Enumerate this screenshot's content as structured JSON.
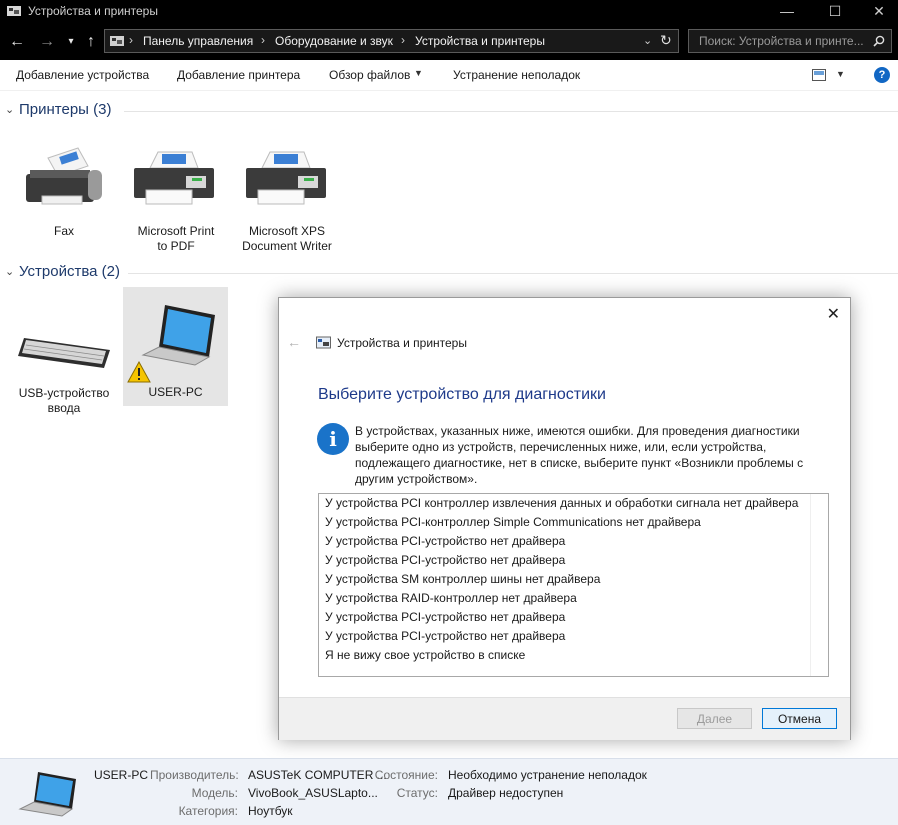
{
  "window": {
    "title": "Устройства и принтеры",
    "controls": {
      "minimize": "—",
      "maximize": "☐",
      "close": "✕"
    }
  },
  "address_bar": {
    "crumbs": [
      "Панель управления",
      "Оборудование и звук",
      "Устройства и принтеры"
    ],
    "separator": "›",
    "search_placeholder": "Поиск: Устройства и принте..."
  },
  "toolbar": {
    "add_device": "Добавление устройства",
    "add_printer": "Добавление принтера",
    "browse_files": "Обзор файлов",
    "troubleshoot": "Устранение неполадок",
    "help": "?"
  },
  "groups": {
    "printers": {
      "title": "Принтеры (3)",
      "items": [
        {
          "line1": "Fax",
          "line2": ""
        },
        {
          "line1": "Microsoft Print",
          "line2": "to PDF"
        },
        {
          "line1": "Microsoft XPS",
          "line2": "Document Writer"
        }
      ]
    },
    "devices": {
      "title": "Устройства (2)",
      "items": [
        {
          "line1": "USB-устройство",
          "line2": "ввода"
        },
        {
          "line1": "USER-PC",
          "line2": ""
        }
      ]
    }
  },
  "dialog": {
    "title": "Устройства и принтеры",
    "heading": "Выберите устройство для диагностики",
    "description": "В устройствах, указанных ниже, имеются ошибки. Для проведения диагностики выберите одно из устройств, перечисленных ниже, или, если устройства, подлежащего диагностике, нет в списке, выберите пункт «Возникли проблемы с другим устройством».",
    "items": [
      "У устройства PCI контроллер извлечения данных и обработки сигнала нет драйвера",
      "У устройства PCI-контроллер Simple Communications нет драйвера",
      "У устройства PCI-устройство нет драйвера",
      "У устройства PCI-устройство нет драйвера",
      "У устройства SM контроллер шины нет драйвера",
      "У устройства RAID-контроллер нет драйвера",
      "У устройства PCI-устройство нет драйвера",
      "У устройства PCI-устройство нет драйвера",
      "Я не вижу свое устройство в списке"
    ],
    "next_label": "Далее",
    "cancel_label": "Отмена"
  },
  "details": {
    "name": "USER-PC",
    "manufacturer_label": "Производитель:",
    "manufacturer": "ASUSTeK COMPUTER ...",
    "model_label": "Модель:",
    "model": "VivoBook_ASUSLapto...",
    "category_label": "Категория:",
    "category": "Ноутбук",
    "state_label": "Состояние:",
    "state": "Необходимо устранение неполадок",
    "status_label": "Статус:",
    "status": "Драйвер недоступен"
  },
  "colors": {
    "accent": "#1167c4",
    "heading": "#1e3a8a",
    "group": "#1e3a6b"
  }
}
